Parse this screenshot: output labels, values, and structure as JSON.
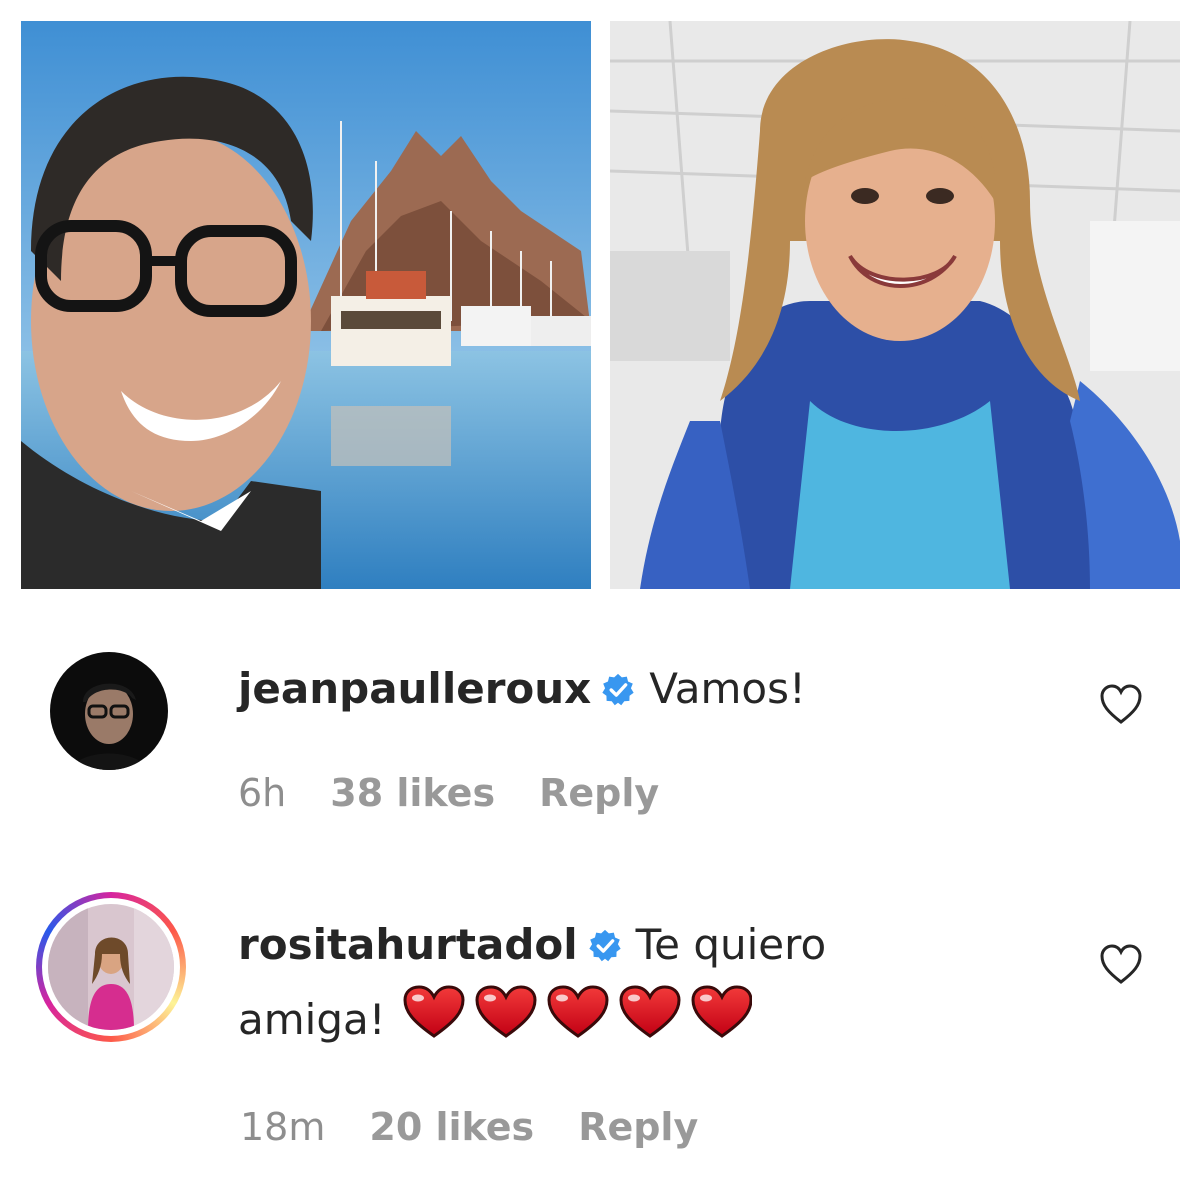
{
  "photos": [
    {
      "name": "man-selfie-harbor-photo",
      "icon": "photo-man-glasses-marina"
    },
    {
      "name": "woman-smiling-blue-feathers-photo",
      "icon": "photo-woman-blue-boa"
    }
  ],
  "comments": [
    {
      "username": "jeanpaulleroux",
      "verified": true,
      "text": "Vamos!",
      "time": "6h",
      "likes": "38 likes",
      "reply": "Reply",
      "has_story_ring": false
    },
    {
      "username": "rositahurtadol",
      "verified": true,
      "text_line1": "Te quiero",
      "text_line2": "amiga!",
      "emoji": "red-heart x5",
      "time": "18m",
      "likes": "20 likes",
      "reply": "Reply",
      "has_story_ring": true
    }
  ],
  "colors": {
    "verified_badge": "#3897f0",
    "heart_emoji": "#e0102a",
    "meta_text": "#8e8e8e",
    "primary_text": "#262626"
  }
}
